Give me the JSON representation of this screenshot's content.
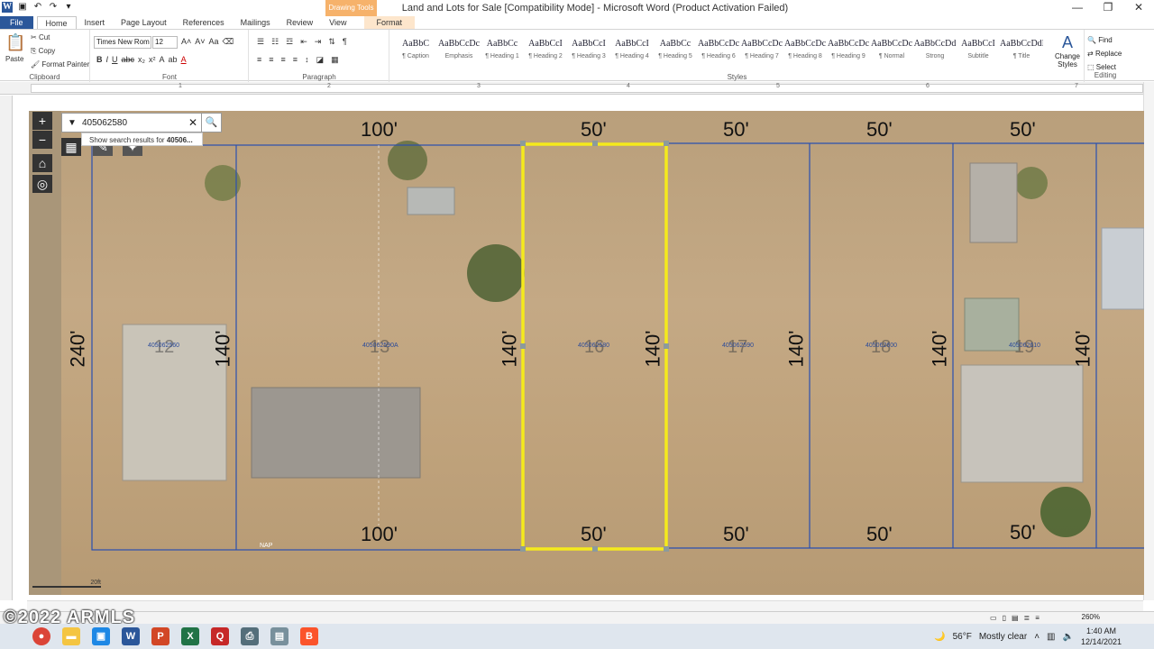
{
  "window": {
    "title": "Land and Lots for Sale [Compatibility Mode]  -  Microsoft Word (Product Activation Failed)",
    "context_tab_group": "Drawing Tools",
    "controls": [
      "?",
      "□",
      "✕"
    ]
  },
  "tabs": [
    "File",
    "Home",
    "Insert",
    "Page Layout",
    "References",
    "Mailings",
    "Review",
    "View",
    "Format"
  ],
  "ribbon": {
    "clipboard": {
      "paste": "Paste",
      "cut": "Cut",
      "copy": "Copy",
      "format_painter": "Format Painter",
      "label": "Clipboard"
    },
    "font": {
      "name": "Times New Rom",
      "size": "12",
      "label": "Font",
      "buttons": [
        "B",
        "I",
        "U",
        "abc",
        "x₂",
        "x²"
      ]
    },
    "paragraph": {
      "label": "Paragraph"
    },
    "styles": {
      "label": "Styles",
      "items": [
        {
          "sample": "AaBbC",
          "name": "¶ Caption"
        },
        {
          "sample": "AaBbCcDc",
          "name": "Emphasis"
        },
        {
          "sample": "AaBbCc",
          "name": "¶ Heading 1"
        },
        {
          "sample": "AaBbCcI",
          "name": "¶ Heading 2"
        },
        {
          "sample": "AaBbCcI",
          "name": "¶ Heading 3"
        },
        {
          "sample": "AaBbCcI",
          "name": "¶ Heading 4"
        },
        {
          "sample": "AaBbCc",
          "name": "¶ Heading 5"
        },
        {
          "sample": "AaBbCcDc",
          "name": "¶ Heading 6"
        },
        {
          "sample": "AaBbCcDc",
          "name": "¶ Heading 7"
        },
        {
          "sample": "AaBbCcDc",
          "name": "¶ Heading 8"
        },
        {
          "sample": "AaBbCcDc",
          "name": "¶ Heading 9"
        },
        {
          "sample": "AaBbCcDc",
          "name": "¶ Normal"
        },
        {
          "sample": "AaBbCcDd",
          "name": "Strong"
        },
        {
          "sample": "AaBbCcI",
          "name": "Subtitle"
        },
        {
          "sample": "AaBbCcDdI",
          "name": "¶ Title"
        }
      ],
      "change_styles": "Change Styles"
    },
    "editing": {
      "find": "Find",
      "replace": "Replace",
      "select": "Select",
      "label": "Editing"
    }
  },
  "ruler_numbers": [
    "1",
    "2",
    "3",
    "4",
    "5",
    "6",
    "7"
  ],
  "map": {
    "search_value": "405062580",
    "search_suggestion_prefix": "Show search results for ",
    "search_suggestion_bold": "40506...",
    "dimensions_top": [
      "100'",
      "50'",
      "50'",
      "50'",
      "50'"
    ],
    "dimensions_bottom": [
      "100'",
      "50'",
      "50'",
      "50'",
      "50'"
    ],
    "dimensions_side": [
      "240'",
      "140'",
      "140'",
      "140'",
      "140'",
      "140'",
      "140'"
    ],
    "lot_numbers": [
      "12",
      "13",
      "16",
      "17",
      "18",
      "19"
    ],
    "parcel_ids": [
      "405062560",
      "405062590A",
      "405062580",
      "405062590",
      "405062600",
      "405062610"
    ],
    "scale_label": "20ft",
    "nap_label": "NAP",
    "highlight_color": "#f5ea1c",
    "parcel_line_color": "#2a4fb0"
  },
  "watermark": "©2022 ARMLS",
  "status": {
    "zoom": "260%"
  },
  "taskbar": {
    "weather_temp": "56°F",
    "weather_desc": "Mostly clear",
    "time": "1:40 AM",
    "date": "12/14/2021"
  }
}
